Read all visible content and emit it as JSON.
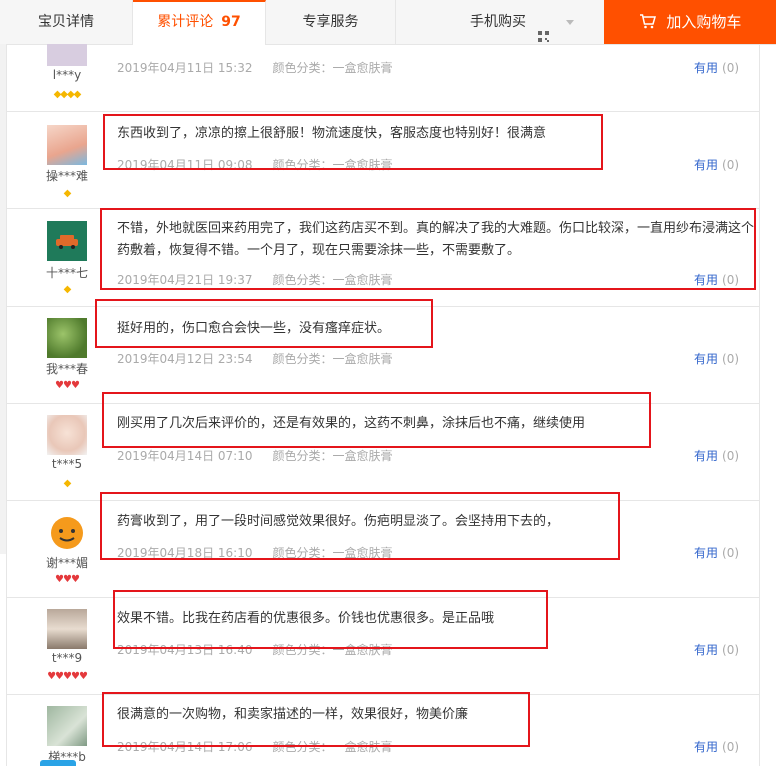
{
  "tabs": [
    {
      "label": "宝贝详情"
    },
    {
      "label": "累计评论",
      "count": "97"
    },
    {
      "label": "专享服务"
    }
  ],
  "mobile_buy": {
    "label": "手机购买"
  },
  "cart": {
    "label": "加入购物车"
  },
  "colors": {
    "accent": "#ff5000",
    "link": "#3366cc",
    "highlight": "#e4151b"
  },
  "reviews": [
    {
      "user": "l***y",
      "rank": "◆◆◆◆",
      "rank_type": "diamond",
      "content": "",
      "date": "2019年04月11日 15:32",
      "color_label": "颜色分类：一盒愈肤膏",
      "useful": "有用",
      "useful_count": "(0)"
    },
    {
      "user": "操***难",
      "rank": "◆",
      "rank_type": "diamond",
      "content": "东西收到了，凉凉的擦上很舒服！物流速度快，客服态度也特别好！很满意",
      "date": "2019年04月11日 09:08",
      "color_label": "颜色分类：一盒愈肤膏",
      "useful": "有用",
      "useful_count": "(0)"
    },
    {
      "user": "十***七",
      "rank": "◆",
      "rank_type": "diamond",
      "content": "不错，外地就医回来药用完了，我们这药店买不到。真的解决了我的大难题。伤口比较深，一直用纱布浸满这个药敷着，恢复得不错。一个月了，现在只需要涂抹一些，不需要敷了。",
      "date": "2019年04月21日 19:37",
      "color_label": "颜色分类：一盒愈肤膏",
      "useful": "有用",
      "useful_count": "(0)"
    },
    {
      "user": "我***春",
      "rank": "♥♥♥",
      "rank_type": "heart",
      "content": "挺好用的，伤口愈合会快一些，没有瘙痒症状。",
      "date": "2019年04月12日 23:54",
      "color_label": "颜色分类：一盒愈肤膏",
      "useful": "有用",
      "useful_count": "(0)"
    },
    {
      "user": "t***5",
      "rank": "◆",
      "rank_type": "diamond",
      "content": "刚买用了几次后来评价的，还是有效果的，这药不刺鼻，涂抹后也不痛，继续使用",
      "date": "2019年04月14日 07:10",
      "color_label": "颜色分类：一盒愈肤膏",
      "useful": "有用",
      "useful_count": "(0)"
    },
    {
      "user": "谢***媚",
      "rank": "♥♥♥",
      "rank_type": "heart",
      "content": "药膏收到了，用了一段时间感觉效果很好。伤疤明显淡了。会坚持用下去的，",
      "date": "2019年04月18日 16:10",
      "color_label": "颜色分类：一盒愈肤膏",
      "useful": "有用",
      "useful_count": "(0)"
    },
    {
      "user": "t***9",
      "rank": "♥♥♥♥♥",
      "rank_type": "heart",
      "content": "效果不错。比我在药店看的优惠很多。价钱也优惠很多。是正品哦",
      "date": "2019年04月13日 16:40",
      "color_label": "颜色分类：一盒愈肤膏",
      "useful": "有用",
      "useful_count": "(0)"
    },
    {
      "user": "梯***b",
      "rank": "",
      "rank_type": "diamond",
      "content": "很满意的一次购物，和卖家描述的一样，效果很好，物美价廉",
      "date": "2019年04月14日 17:06",
      "color_label": "颜色分类：一盒愈肤膏",
      "useful": "有用",
      "useful_count": "(0)"
    }
  ]
}
